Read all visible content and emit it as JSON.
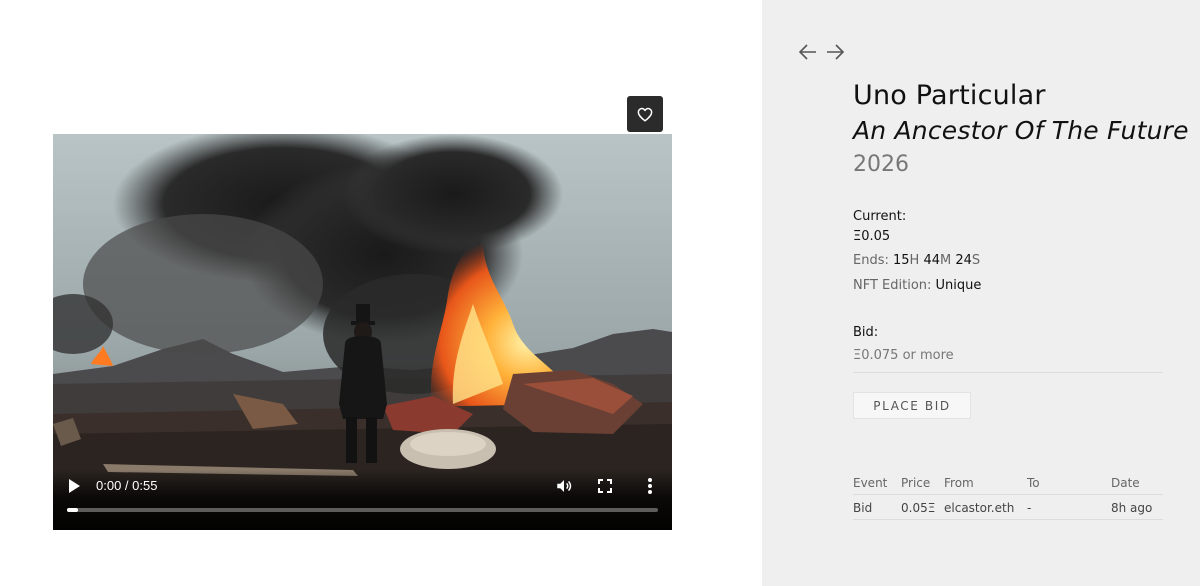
{
  "player": {
    "time": "0:00 / 0:55",
    "progress_fraction": 0.018
  },
  "artwork": {
    "artist": "Uno Particular",
    "title": "An Ancestor Of The Future",
    "year": "2026"
  },
  "auction": {
    "current_label": "Current:",
    "current_value": "Ξ0.05",
    "ends_label": "Ends:",
    "ends_hours": "15",
    "ends_hours_unit": "H",
    "ends_minutes": "44",
    "ends_minutes_unit": "M",
    "ends_seconds": "24",
    "ends_seconds_unit": "S",
    "edition_label": "NFT Edition:",
    "edition_value": "Unique",
    "bid_label": "Bid:",
    "bid_hint": "Ξ0.075 or more",
    "place_bid_label": "PLACE BID"
  },
  "history": {
    "headers": [
      "Event",
      "Price",
      "From",
      "To",
      "Date"
    ],
    "rows": [
      [
        "Bid",
        "0.05Ξ",
        "elcastor.eth",
        "-",
        "8h ago"
      ]
    ]
  },
  "icons": {
    "favorite": "heart-icon",
    "prev": "arrow-left-icon",
    "next": "arrow-right-icon",
    "play": "play-icon",
    "volume": "volume-icon",
    "fullscreen": "fullscreen-icon",
    "more": "more-vertical-icon"
  }
}
